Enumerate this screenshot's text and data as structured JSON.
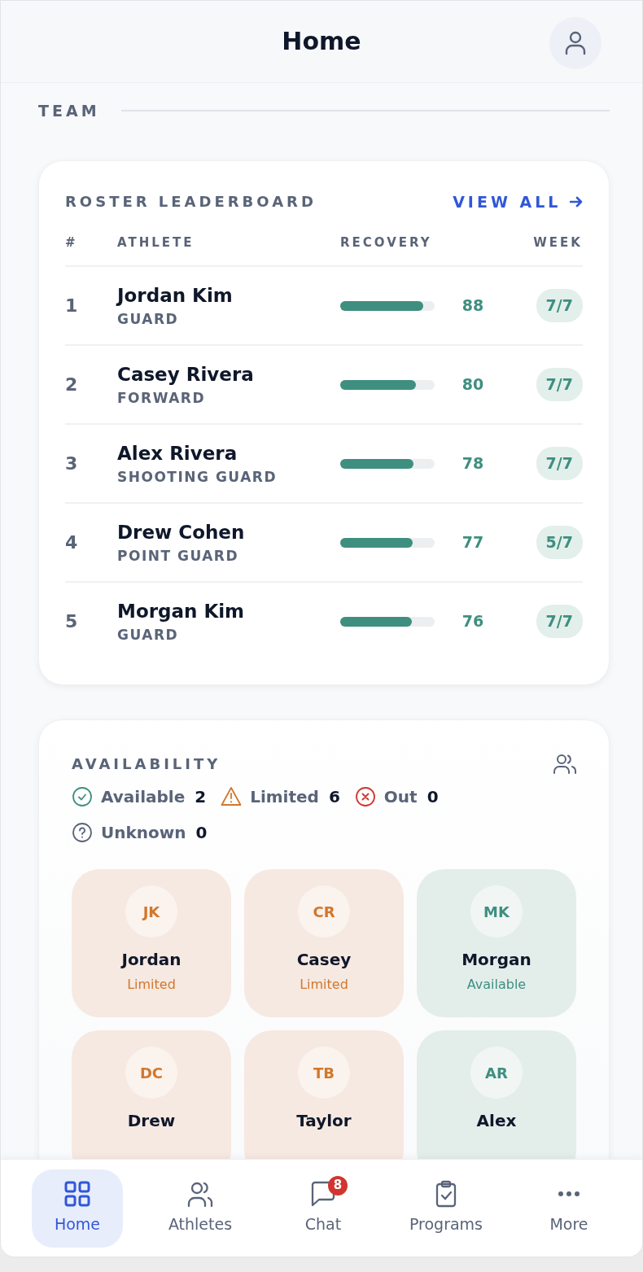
{
  "header": {
    "title": "Home"
  },
  "section": {
    "title": "TEAM"
  },
  "leaderboard": {
    "title": "ROSTER LEADERBOARD",
    "link": "VIEW ALL",
    "columns": [
      "#",
      "ATHLETE",
      "RECOVERY",
      "WEEK"
    ],
    "rows": [
      {
        "rank": "1",
        "name": "Jordan Kim",
        "position": "GUARD",
        "level": 0.88,
        "score": "88",
        "week": "7/7"
      },
      {
        "rank": "2",
        "name": "Casey Rivera",
        "position": "FORWARD",
        "level": 0.8,
        "score": "80",
        "week": "7/7"
      },
      {
        "rank": "3",
        "name": "Alex Rivera",
        "position": "SHOOTING GUARD",
        "level": 0.78,
        "score": "78",
        "week": "7/7"
      },
      {
        "rank": "4",
        "name": "Drew Cohen",
        "position": "POINT GUARD",
        "level": 0.77,
        "score": "77",
        "week": "5/7"
      },
      {
        "rank": "5",
        "name": "Morgan Kim",
        "position": "GUARD",
        "level": 0.76,
        "score": "76",
        "week": "7/7"
      }
    ]
  },
  "availability": {
    "title": "AVAILABILITY",
    "legend": [
      {
        "kind": "available",
        "label": "Available",
        "count": "2"
      },
      {
        "kind": "limited",
        "label": "Limited",
        "count": "6"
      },
      {
        "kind": "out",
        "label": "Out",
        "count": "0"
      },
      {
        "kind": "unknown",
        "label": "Unknown",
        "count": "0"
      }
    ],
    "athletes": [
      {
        "kind": "limited",
        "initials": "JK",
        "name": "Jordan",
        "status": "Limited"
      },
      {
        "kind": "limited",
        "initials": "CR",
        "name": "Casey",
        "status": "Limited"
      },
      {
        "kind": "available",
        "initials": "MK",
        "name": "Morgan",
        "status": "Available"
      },
      {
        "kind": "limited",
        "initials": "DC",
        "name": "Drew"
      },
      {
        "kind": "limited",
        "initials": "TB",
        "name": "Taylor"
      },
      {
        "kind": "available",
        "initials": "AR",
        "name": "Alex"
      }
    ]
  },
  "nav": [
    {
      "kind": "home",
      "label": "Home",
      "selected": true
    },
    {
      "kind": "athletes",
      "label": "Athletes",
      "selected": false
    },
    {
      "kind": "chat",
      "label": "Chat",
      "selected": false,
      "badge": "8"
    },
    {
      "kind": "programs",
      "label": "Programs",
      "selected": false
    },
    {
      "kind": "more",
      "label": "More",
      "selected": false
    }
  ]
}
